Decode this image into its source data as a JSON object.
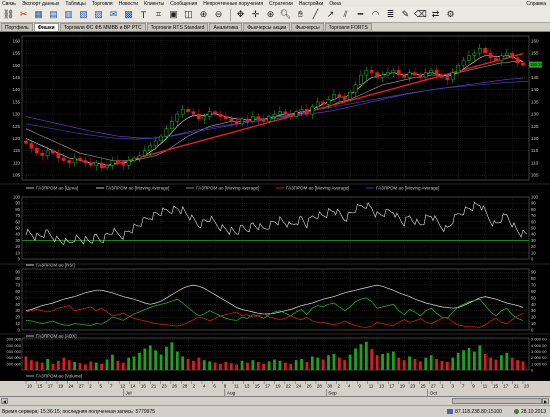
{
  "menu": {
    "items": [
      "Связь",
      "Экспорт данных",
      "Таблицы",
      "Торговля",
      "Новости",
      "Клиенты",
      "Сообщения",
      "Непрочтенные поручения",
      "Стратегии",
      "Настройки",
      "Окна"
    ],
    "right": "Справка"
  },
  "tabs": [
    {
      "label": "Портфель",
      "active": false
    },
    {
      "label": "Фишки",
      "active": true
    },
    {
      "label": "Торговля ФС ФБ ММВБ и ВР РТС",
      "active": false
    },
    {
      "label": "Торговля RTS Standard",
      "active": false
    },
    {
      "label": "Аналитика",
      "active": false
    },
    {
      "label": "Фьючерсы акции",
      "active": false
    },
    {
      "label": "Фьючерсы",
      "active": false
    },
    {
      "label": "Торговля FORTS",
      "active": false
    }
  ],
  "colors": {
    "candle_up": "#20c020",
    "candle_down": "#e02020",
    "ma_white": "#e8e8e8",
    "ma_gray": "#a0a0a0",
    "ma_red": "#ee2222",
    "ma_purple": "#6a3aaa",
    "ma_blue": "#3344bb",
    "rsi_line": "#e8e8e8",
    "level_line": "#22aa22",
    "adx_white": "#e0e0e0",
    "adx_green": "#20c020",
    "adx_red": "#e02020",
    "vol_up": "#20a020",
    "vol_down": "#d02020",
    "grid": "#3c3c3c",
    "price_marker": "#22aa22"
  },
  "price_pane": {
    "legend": [
      {
        "name": "ГАЗПРОМ ао [Цена]",
        "color": "#e8e8e8"
      },
      {
        "name": "ГАЗПРОМ ао [Moving Average]",
        "color": "#e8e8e8"
      },
      {
        "name": "ГАЗПРОМ ао [Moving Average]",
        "color": "#a0a0a0"
      },
      {
        "name": "ГАЗПРОМ ао [Moving Average]",
        "color": "#ee2222"
      },
      {
        "name": "ГАЗПРОМ ао [Moving Average]",
        "color": "#6a3aaa"
      }
    ],
    "y_ticks": [
      "160",
      "155",
      "150",
      "145",
      "140",
      "135",
      "130",
      "125",
      "120",
      "115",
      "110",
      "105"
    ],
    "y_min": 103,
    "y_max": 162,
    "last_price": "150.28"
  },
  "rsi_pane": {
    "label": "ГАЗПРОМ ао [RSI]",
    "y_ticks": [
      "100",
      "90",
      "80",
      "70",
      "60",
      "50",
      "40",
      "30",
      "20",
      "10",
      "0"
    ],
    "level": 30
  },
  "adx_pane": {
    "label": "ГАЗПРОМ ао [ADX]",
    "y_ticks": [
      "90",
      "80",
      "70",
      "60",
      "50",
      "40",
      "30",
      "20",
      "10",
      "0"
    ]
  },
  "volume_pane": {
    "label": "ГАЗПРОМ ао [Volume]",
    "left_ticks": [
      "000 000",
      "000 000",
      "000 000",
      "000 000",
      "000 000"
    ],
    "right_ticks": [
      "5 000 00",
      "4 000 00",
      "3 000 00",
      "2 000 00",
      "1 000 00",
      "0"
    ]
  },
  "time_axis": {
    "day_labels": [
      "10",
      "15",
      "17",
      "19",
      "24",
      "27",
      "2",
      "5",
      "7",
      "12",
      "14",
      "16",
      "21",
      "23",
      "26",
      "28",
      "2",
      "4",
      "6",
      "8",
      "11",
      "13",
      "15",
      "17",
      "19",
      "22",
      "24",
      "26",
      "28",
      "30",
      "2",
      "4",
      "9",
      "11",
      "13",
      "17",
      "19",
      "23",
      "25",
      "27",
      "1",
      "3",
      "7",
      "9",
      "11",
      "15",
      "17",
      "21",
      "23"
    ],
    "month_labels": [
      {
        "label": "Jul",
        "at": 0.2
      },
      {
        "label": "Aug",
        "at": 0.4
      },
      {
        "label": "Sep",
        "at": 0.6
      },
      {
        "label": "Oct",
        "at": 0.8
      }
    ]
  },
  "chart_data": {
    "type": "candlestick",
    "title": "ГАЗПРОМ ао",
    "close": [
      118,
      116,
      114,
      113,
      115,
      114,
      112,
      111,
      110,
      112,
      111,
      110,
      109,
      110,
      108,
      109,
      111,
      110,
      109,
      111,
      112,
      113,
      115,
      117,
      119,
      121,
      124,
      127,
      130,
      132,
      131,
      130,
      128,
      129,
      131,
      130,
      129,
      128,
      127,
      126,
      128,
      127,
      129,
      128,
      127,
      129,
      130,
      131,
      130,
      129,
      131,
      132,
      130,
      133,
      135,
      134,
      136,
      138,
      137,
      136,
      139,
      142,
      146,
      148,
      147,
      145,
      146,
      147,
      148,
      146,
      145,
      147,
      146,
      145,
      147,
      148,
      146,
      145,
      144,
      147,
      150,
      152,
      154,
      155,
      157,
      155,
      153,
      152,
      154,
      155,
      153,
      151,
      150
    ],
    "series": [
      {
        "name": "ГАЗПРОМ ао [Moving Average] fast",
        "values": [
          120,
          119,
          118,
          117,
          116,
          115,
          114,
          113,
          112,
          111.5,
          111,
          110.5,
          110,
          110,
          109.5,
          109,
          109.5,
          110,
          110,
          110.5,
          111,
          112,
          113,
          114.5,
          116,
          118,
          120,
          122.5,
          125,
          127,
          128.5,
          129.5,
          129.5,
          129.5,
          130,
          130,
          129.5,
          129,
          128.5,
          128,
          128,
          127.5,
          128,
          128,
          128,
          128.5,
          129,
          129.5,
          130,
          130,
          130.5,
          131,
          131,
          132,
          133,
          134,
          135,
          136,
          137,
          137,
          138,
          139.5,
          141.5,
          143.5,
          145,
          145.5,
          146,
          146.5,
          147,
          146.5,
          146,
          146.5,
          146.5,
          146,
          146.5,
          147,
          146.5,
          146,
          145.5,
          146,
          147,
          148.5,
          150,
          151.5,
          153,
          154,
          154,
          153.5,
          153.5,
          154,
          153.5,
          152.5,
          151.5
        ]
      },
      {
        "name": "ГАЗПРОМ ао [Moving Average] slow",
        "values": [
          124,
          123,
          122,
          121,
          120,
          119,
          118,
          117,
          116,
          115,
          114,
          113.5,
          113,
          112.5,
          112,
          111.5,
          111,
          111,
          111,
          111,
          111,
          111.5,
          112,
          112.5,
          113,
          114,
          115,
          116.5,
          118,
          119.5,
          121,
          122,
          123,
          124,
          125,
          125.5,
          126,
          126.5,
          127,
          127,
          127,
          127,
          127.5,
          128,
          128,
          128,
          128.5,
          129,
          129,
          129.5,
          130,
          130.5,
          131,
          131.5,
          132,
          132.5,
          133,
          134,
          135,
          135.5,
          136,
          137,
          138,
          139,
          140,
          141,
          142,
          142.5,
          143,
          143.5,
          144,
          144.5,
          145,
          145,
          145.5,
          146,
          146,
          146,
          146,
          146.5,
          147,
          147.5,
          148,
          148.5,
          149,
          149.5,
          150,
          150.5,
          151,
          151,
          151.5,
          151.5,
          151.5
        ]
      },
      {
        "name": "ГАЗПРОМ ао [Moving Average] trend",
        "values": [
          null,
          null,
          null,
          null,
          null,
          null,
          null,
          null,
          null,
          null,
          null,
          null,
          null,
          null,
          108,
          108.6,
          109.2,
          109.8,
          110.4,
          111,
          111.6,
          112.2,
          112.8,
          113.4,
          114,
          114.6,
          115.2,
          115.8,
          116.4,
          117,
          117.6,
          118.2,
          118.8,
          119.4,
          120,
          120.6,
          121.2,
          121.8,
          122.4,
          123,
          123.6,
          124.2,
          124.8,
          125.4,
          126,
          126.6,
          127.2,
          127.8,
          128.4,
          129,
          129.6,
          130.2,
          130.8,
          131.4,
          132,
          132.6,
          133.2,
          133.8,
          134.4,
          135,
          135.6,
          136.2,
          136.8,
          137.4,
          138,
          138.6,
          139.2,
          139.8,
          140.4,
          141,
          141.6,
          142.2,
          142.8,
          143.4,
          144,
          144.6,
          145.2,
          145.8,
          146.4,
          147,
          147.6,
          148.2,
          148.8,
          149.4,
          150,
          150.6,
          151.2,
          151.8,
          152.4,
          153,
          153.6,
          154.2,
          154.8
        ]
      },
      {
        "name": "ГАЗПРОМ ао [Moving Average] long",
        "values": [
          129,
          128.5,
          128,
          127.5,
          127,
          126.5,
          126,
          125.5,
          125,
          124.5,
          124,
          123.5,
          123,
          122.6,
          122.2,
          121.8,
          121.4,
          121,
          120.8,
          120.6,
          120.4,
          120.2,
          120.2,
          120.2,
          120.3,
          120.5,
          120.8,
          121.2,
          121.7,
          122.2,
          122.7,
          123.2,
          123.6,
          124,
          124.4,
          124.8,
          125.1,
          125.4,
          125.7,
          126,
          126.3,
          126.6,
          126.9,
          127.2,
          127.5,
          127.8,
          128.1,
          128.4,
          128.7,
          129,
          129.3,
          129.6,
          129.9,
          130.2,
          130.5,
          130.8,
          131.1,
          131.5,
          132,
          132.5,
          133,
          133.5,
          134,
          134.5,
          135,
          135.5,
          136,
          136.5,
          137,
          137.5,
          138,
          138.4,
          138.8,
          139.2,
          139.6,
          140,
          140.3,
          140.6,
          140.9,
          141.2,
          141.5,
          141.8,
          142.1,
          142.4,
          142.7,
          143,
          143.3,
          143.6,
          143.9,
          144.2,
          144.4,
          144.6,
          144.8
        ]
      },
      {
        "name": "ГАЗПРОМ ао [Moving Average] longer",
        "values": [
          126,
          125.6,
          125.2,
          124.8,
          124.4,
          124,
          123.6,
          123.2,
          122.8,
          122.4,
          122,
          121.7,
          121.4,
          121.1,
          120.8,
          120.5,
          120.3,
          120.1,
          120,
          119.9,
          119.8,
          119.8,
          119.9,
          120,
          120.2,
          120.4,
          120.7,
          121,
          121.4,
          121.8,
          122.2,
          122.6,
          123,
          123.4,
          123.8,
          124.2,
          124.6,
          125,
          125.4,
          125.8,
          126.2,
          126.6,
          127,
          127.4,
          127.8,
          128.2,
          128.6,
          129,
          129.4,
          129.8,
          130.2,
          130.6,
          131,
          131.4,
          131.8,
          132.2,
          132.6,
          133,
          133.4,
          133.8,
          134.2,
          134.6,
          135,
          135.4,
          135.8,
          136.2,
          136.6,
          137,
          137.4,
          137.8,
          138.2,
          138.6,
          139,
          139.3,
          139.6,
          139.9,
          140.2,
          140.5,
          140.8,
          141,
          141.2,
          141.4,
          141.6,
          141.8,
          142,
          142.2,
          142.4,
          142.6,
          142.8,
          143,
          143.1,
          143.2,
          143.3,
          143.4
        ]
      }
    ],
    "rsi": [
      45,
      40,
      35,
      38,
      42,
      36,
      30,
      28,
      25,
      35,
      32,
      30,
      28,
      35,
      30,
      38,
      45,
      40,
      38,
      45,
      50,
      55,
      62,
      68,
      72,
      75,
      78,
      80,
      82,
      78,
      70,
      62,
      55,
      60,
      65,
      58,
      52,
      48,
      45,
      42,
      50,
      48,
      55,
      52,
      48,
      55,
      60,
      62,
      58,
      52,
      60,
      65,
      55,
      68,
      72,
      70,
      75,
      78,
      72,
      65,
      72,
      80,
      85,
      88,
      82,
      70,
      72,
      75,
      78,
      65,
      58,
      68,
      62,
      55,
      65,
      70,
      60,
      52,
      48,
      62,
      72,
      78,
      82,
      85,
      88,
      75,
      62,
      55,
      65,
      70,
      58,
      45,
      40
    ],
    "adx_white": [
      30,
      32,
      35,
      38,
      40,
      42,
      45,
      48,
      50,
      52,
      55,
      58,
      60,
      62,
      62,
      60,
      58,
      55,
      52,
      50,
      48,
      45,
      42,
      40,
      42,
      45,
      50,
      55,
      60,
      65,
      68,
      70,
      68,
      65,
      60,
      55,
      50,
      45,
      40,
      35,
      32,
      30,
      28,
      26,
      25,
      25,
      26,
      28,
      30,
      32,
      35,
      38,
      40,
      42,
      45,
      48,
      50,
      52,
      55,
      58,
      60,
      62,
      64,
      66,
      68,
      70,
      68,
      65,
      62,
      58,
      55,
      52,
      48,
      45,
      42,
      40,
      38,
      36,
      35,
      34,
      35,
      38,
      42,
      46,
      50,
      52,
      50,
      48,
      45,
      42,
      40,
      38,
      35
    ],
    "adx_green": [
      15,
      14,
      12,
      10,
      12,
      14,
      10,
      8,
      7,
      10,
      9,
      8,
      7,
      10,
      9,
      14,
      20,
      18,
      15,
      20,
      25,
      28,
      32,
      35,
      38,
      40,
      42,
      45,
      48,
      42,
      35,
      28,
      22,
      25,
      30,
      26,
      22,
      18,
      16,
      15,
      20,
      18,
      24,
      22,
      18,
      24,
      28,
      30,
      26,
      22,
      28,
      32,
      24,
      34,
      38,
      36,
      40,
      42,
      36,
      30,
      36,
      44,
      48,
      50,
      44,
      34,
      36,
      38,
      40,
      30,
      24,
      32,
      28,
      22,
      30,
      34,
      26,
      20,
      18,
      28,
      36,
      40,
      44,
      46,
      48,
      38,
      28,
      22,
      30,
      34,
      24,
      18,
      15
    ],
    "adx_red": [
      28,
      30,
      32,
      30,
      28,
      30,
      34,
      36,
      38,
      30,
      32,
      34,
      36,
      30,
      34,
      28,
      22,
      24,
      26,
      22,
      18,
      16,
      14,
      12,
      10,
      9,
      8,
      7,
      6,
      8,
      12,
      16,
      20,
      18,
      14,
      18,
      22,
      24,
      26,
      28,
      22,
      24,
      20,
      22,
      26,
      20,
      18,
      16,
      18,
      22,
      18,
      16,
      20,
      14,
      12,
      12,
      10,
      8,
      10,
      14,
      10,
      7,
      5,
      4,
      6,
      12,
      10,
      8,
      7,
      12,
      16,
      12,
      14,
      18,
      12,
      10,
      14,
      18,
      20,
      12,
      8,
      6,
      5,
      5,
      4,
      8,
      14,
      18,
      12,
      10,
      16,
      22,
      26
    ],
    "volume": [
      2.2,
      1.6,
      1.4,
      1.2,
      1.8,
      1.0,
      1.5,
      2.0,
      1.6,
      1.3,
      1.1,
      0.9,
      1.4,
      1.2,
      1.0,
      1.7,
      2.5,
      1.5,
      1.2,
      2.0,
      2.2,
      2.8,
      3.5,
      4.0,
      3.2,
      2.5,
      3.8,
      4.5,
      3.0,
      2.2,
      1.8,
      1.5,
      2.0,
      1.6,
      1.4,
      1.2,
      1.0,
      1.3,
      1.1,
      0.9,
      1.5,
      1.2,
      1.6,
      1.3,
      1.0,
      1.4,
      1.7,
      1.5,
      1.2,
      1.0,
      1.6,
      1.8,
      1.3,
      2.2,
      2.0,
      1.7,
      2.4,
      2.6,
      2.0,
      1.6,
      2.5,
      3.5,
      4.2,
      4.6,
      3.4,
      2.4,
      2.6,
      2.8,
      3.0,
      2.0,
      1.6,
      2.2,
      1.8,
      1.4,
      2.0,
      2.4,
      1.8,
      1.5,
      1.3,
      2.0,
      2.8,
      3.2,
      3.6,
      3.0,
      4.0,
      2.6,
      2.0,
      1.7,
      2.4,
      2.8,
      2.0,
      1.6,
      1.4
    ],
    "ylim": [
      103,
      162
    ]
  },
  "status": {
    "server_time": "Время сервера: 15:36:15; последняя полученная запись: 5779975",
    "connection": "87.118.238.80:15100",
    "date": "28.10.2013"
  }
}
